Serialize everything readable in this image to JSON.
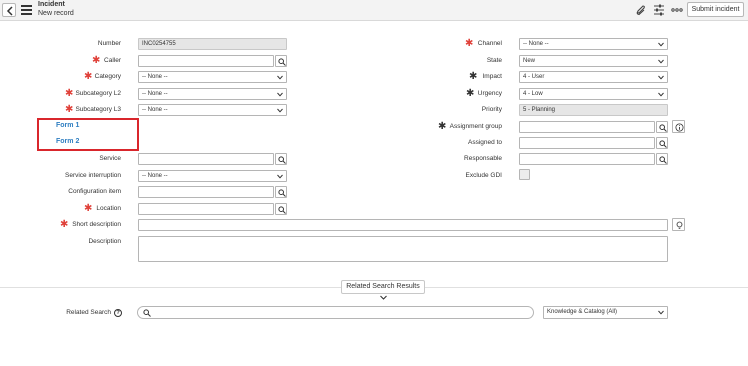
{
  "header": {
    "title": "Incident",
    "subtitle": "New record",
    "submit_label": "Submit incident"
  },
  "left_fields": {
    "number": {
      "label": "Number",
      "value": "INC0254755"
    },
    "caller": {
      "label": "Caller",
      "value": ""
    },
    "category": {
      "label": "Category",
      "value": "-- None --"
    },
    "subcategory_l2": {
      "label": "Subcategory L2",
      "value": "-- None --"
    },
    "subcategory_l3": {
      "label": "Subcategory L3",
      "value": "-- None --"
    },
    "service": {
      "label": "Service",
      "value": ""
    },
    "service_interruption": {
      "label": "Service interruption",
      "value": "-- None --"
    },
    "configuration_item": {
      "label": "Configuration item",
      "value": ""
    },
    "location": {
      "label": "Location",
      "value": ""
    },
    "short_description": {
      "label": "Short description",
      "value": ""
    },
    "description": {
      "label": "Description",
      "value": ""
    }
  },
  "form_links": {
    "form1": "Form 1",
    "form2": "Form 2"
  },
  "right_fields": {
    "channel": {
      "label": "Channel",
      "value": "-- None --"
    },
    "state": {
      "label": "State",
      "value": "New"
    },
    "impact": {
      "label": "Impact",
      "value": "4 - User"
    },
    "urgency": {
      "label": "Urgency",
      "value": "4 - Low"
    },
    "priority": {
      "label": "Priority",
      "value": "5 - Planning"
    },
    "assignment_group": {
      "label": "Assignment group",
      "value": ""
    },
    "assigned_to": {
      "label": "Assigned to",
      "value": ""
    },
    "responsable": {
      "label": "Responsable",
      "value": ""
    },
    "exclude_gdi": {
      "label": "Exclude GDI",
      "checked": false
    }
  },
  "related": {
    "button_label": "Related Search Results",
    "search_label": "Related Search",
    "search_value": "",
    "scope_value": "Knowledge & Catalog (All)"
  },
  "colors": {
    "required": "#e0413a",
    "link": "#2e7ec1",
    "highlight_box": "#d9262c"
  }
}
